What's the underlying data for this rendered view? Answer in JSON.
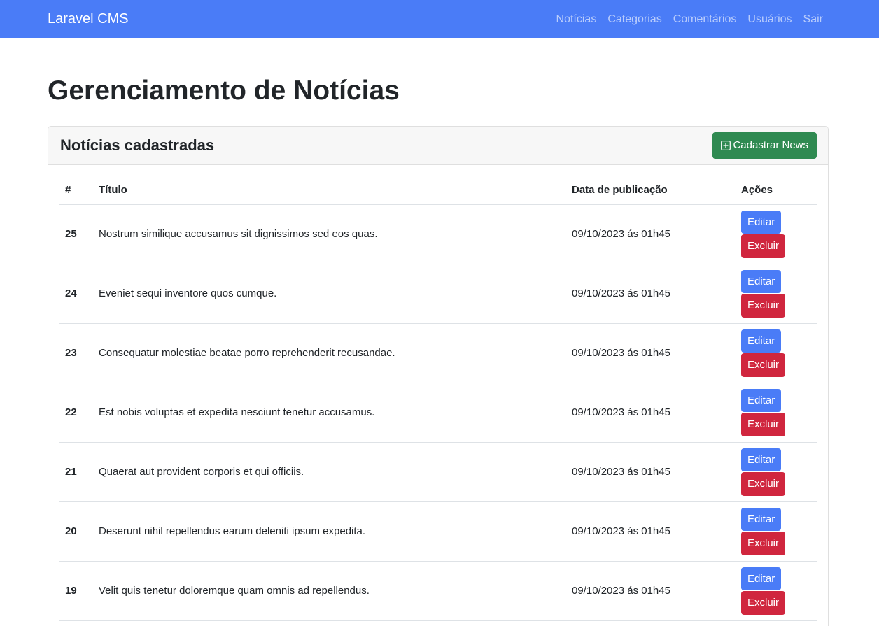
{
  "navbar": {
    "brand": "Laravel CMS",
    "links": [
      "Notícias",
      "Categorias",
      "Comentários",
      "Usuários",
      "Sair"
    ]
  },
  "page": {
    "title": "Gerenciamento de Notícias"
  },
  "card": {
    "title": "Notícias cadastradas",
    "add_button_label": "Cadastrar News",
    "add_button_icon": "plus-square-icon"
  },
  "table": {
    "headers": [
      "#",
      "Título",
      "Data de publicação",
      "Ações"
    ],
    "edit_label": "Editar",
    "delete_label": "Excluir",
    "rows": [
      {
        "id": "25",
        "title": "Nostrum similique accusamus sit dignissimos sed eos quas.",
        "date": "09/10/2023 ás 01h45"
      },
      {
        "id": "24",
        "title": "Eveniet sequi inventore quos cumque.",
        "date": "09/10/2023 ás 01h45"
      },
      {
        "id": "23",
        "title": "Consequatur molestiae beatae porro reprehenderit recusandae.",
        "date": "09/10/2023 ás 01h45"
      },
      {
        "id": "22",
        "title": "Est nobis voluptas et expedita nesciunt tenetur accusamus.",
        "date": "09/10/2023 ás 01h45"
      },
      {
        "id": "21",
        "title": "Quaerat aut provident corporis et qui officiis.",
        "date": "09/10/2023 ás 01h45"
      },
      {
        "id": "20",
        "title": "Deserunt nihil repellendus earum deleniti ipsum expedita.",
        "date": "09/10/2023 ás 01h45"
      },
      {
        "id": "19",
        "title": "Velit quis tenetur doloremque quam omnis ad repellendus.",
        "date": "09/10/2023 ás 01h45"
      }
    ]
  },
  "colors": {
    "navbar": "#4a7cf7",
    "success": "#2f8a51",
    "primary": "#4a7cf7",
    "danger": "#d0263e"
  }
}
